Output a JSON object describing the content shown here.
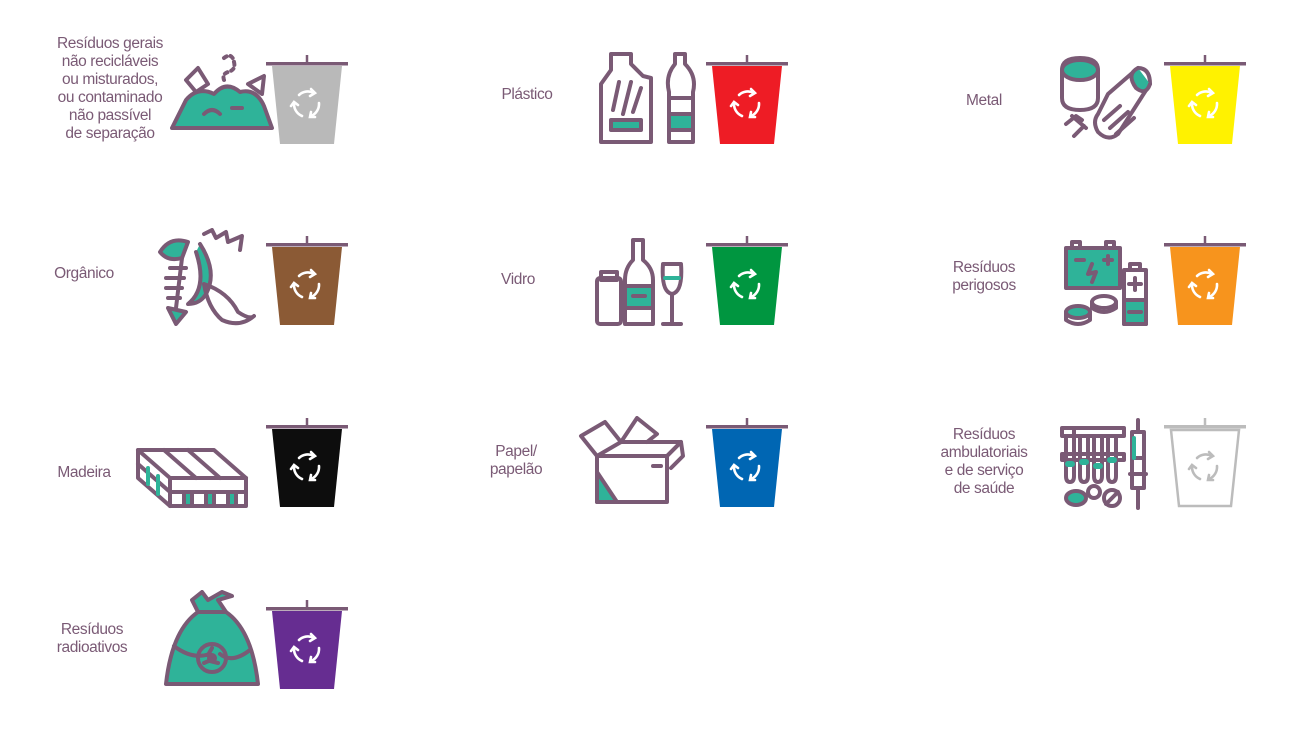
{
  "colors": {
    "stroke": "#7a5a75",
    "accent": "#2fb399",
    "label": "#7a5a75",
    "arrows": "#ffffff"
  },
  "categories": [
    {
      "id": "gerais",
      "label": "Resíduos gerais\nnão recicláveis\nou misturados,\nou contaminado\nnão passível\nde separação",
      "bin_color": "#b9b9b9",
      "icon": "garbage-pile-icon"
    },
    {
      "id": "plastico",
      "label": "Plástico",
      "bin_color": "#ee1c25",
      "icon": "plastic-bottles-icon"
    },
    {
      "id": "metal",
      "label": "Metal",
      "bin_color": "#fff200",
      "icon": "metal-cans-icon"
    },
    {
      "id": "organico",
      "label": "Orgânico",
      "bin_color": "#8b5a35",
      "icon": "organic-waste-icon"
    },
    {
      "id": "vidro",
      "label": "Vidro",
      "bin_color": "#009640",
      "icon": "glass-bottles-icon"
    },
    {
      "id": "perigosos",
      "label": "Resíduos\nperigosos",
      "bin_color": "#f7941d",
      "icon": "batteries-icon"
    },
    {
      "id": "madeira",
      "label": "Madeira",
      "bin_color": "#0d0d0d",
      "icon": "wood-pallet-icon"
    },
    {
      "id": "papel",
      "label": "Papel/\npapelão",
      "bin_color": "#0066b3",
      "icon": "cardboard-box-icon"
    },
    {
      "id": "saude",
      "label": "Resíduos\nambulatoriais\ne de serviço\nde saúde",
      "bin_color": "#ffffff",
      "icon": "medical-waste-icon"
    },
    {
      "id": "radioativos",
      "label": "Resíduos\nradioativos",
      "bin_color": "#662d91",
      "icon": "radioactive-bag-icon"
    }
  ]
}
